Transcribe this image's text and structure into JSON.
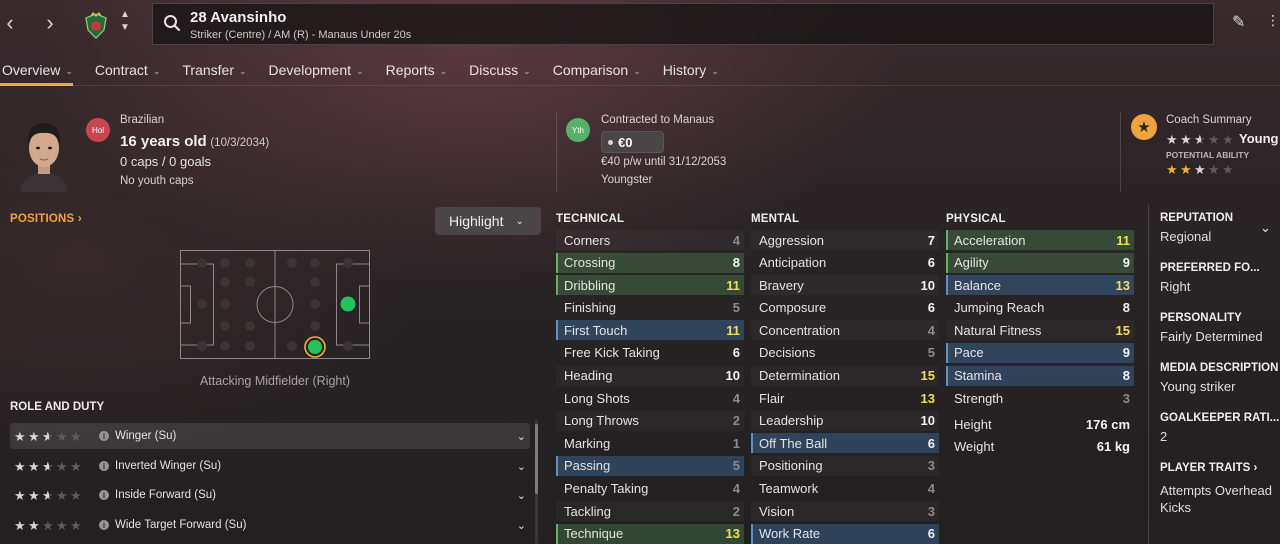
{
  "header": {
    "player_name": "28 Avansinho",
    "player_sub": "Striker (Centre) / AM (R) - Manaus Under 20s"
  },
  "tabs": [
    {
      "label": "Overview"
    },
    {
      "label": "Contract"
    },
    {
      "label": "Transfer"
    },
    {
      "label": "Development"
    },
    {
      "label": "Reports"
    },
    {
      "label": "Discuss"
    },
    {
      "label": "Comparison"
    },
    {
      "label": "History"
    }
  ],
  "info": {
    "nationality_badge": "Hol",
    "nationality": "Brazilian",
    "age": "16 years old",
    "dob": "(10/3/2034)",
    "caps_goals": "0 caps / 0 goals",
    "youth_caps": "No youth caps",
    "contract_badge": "Yth",
    "contracted_to": "Contracted to Manaus",
    "value": "€0",
    "wage": "€40 p/w until 31/12/2053",
    "contract_type": "Youngster",
    "coach_summary_label": "Coach Summary",
    "coach_summary_value": "Young",
    "potential_label": "POTENTIAL ABILITY",
    "current_ability_stars": 2.5,
    "potential_ability_stars": 3
  },
  "positions": {
    "title": "POSITIONS ›",
    "highlight_label": "Highlight",
    "position_label": "Attacking Midfielder (Right)"
  },
  "roles": {
    "title": "ROLE AND DUTY",
    "items": [
      {
        "name": "Winger (Su)",
        "stars": 2.5
      },
      {
        "name": "Inverted Winger (Su)",
        "stars": 2.5
      },
      {
        "name": "Inside Forward (Su)",
        "stars": 2.5
      },
      {
        "name": "Wide Target Forward (Su)",
        "stars": 2
      }
    ]
  },
  "technical": {
    "title": "TECHNICAL",
    "rows": [
      {
        "name": "Corners",
        "value": "4",
        "hl": "plain"
      },
      {
        "name": "Crossing",
        "value": "8",
        "hl": "green"
      },
      {
        "name": "Dribbling",
        "value": "11",
        "hl": "green"
      },
      {
        "name": "Finishing",
        "value": "5",
        "hl": "plain"
      },
      {
        "name": "First Touch",
        "value": "11",
        "hl": "blue"
      },
      {
        "name": "Free Kick Taking",
        "value": "6",
        "hl": "plain"
      },
      {
        "name": "Heading",
        "value": "10",
        "hl": "plain"
      },
      {
        "name": "Long Shots",
        "value": "4",
        "hl": "plain"
      },
      {
        "name": "Long Throws",
        "value": "2",
        "hl": "plain"
      },
      {
        "name": "Marking",
        "value": "1",
        "hl": "plain"
      },
      {
        "name": "Passing",
        "value": "5",
        "hl": "blue"
      },
      {
        "name": "Penalty Taking",
        "value": "4",
        "hl": "plain"
      },
      {
        "name": "Tackling",
        "value": "2",
        "hl": "plain"
      },
      {
        "name": "Technique",
        "value": "13",
        "hl": "green"
      }
    ]
  },
  "mental": {
    "title": "MENTAL",
    "rows": [
      {
        "name": "Aggression",
        "value": "7",
        "hl": "plain"
      },
      {
        "name": "Anticipation",
        "value": "6",
        "hl": "plain"
      },
      {
        "name": "Bravery",
        "value": "10",
        "hl": "plain"
      },
      {
        "name": "Composure",
        "value": "6",
        "hl": "plain"
      },
      {
        "name": "Concentration",
        "value": "4",
        "hl": "plain"
      },
      {
        "name": "Decisions",
        "value": "5",
        "hl": "plain"
      },
      {
        "name": "Determination",
        "value": "15",
        "hl": "plain"
      },
      {
        "name": "Flair",
        "value": "13",
        "hl": "plain"
      },
      {
        "name": "Leadership",
        "value": "10",
        "hl": "plain"
      },
      {
        "name": "Off The Ball",
        "value": "6",
        "hl": "blue"
      },
      {
        "name": "Positioning",
        "value": "3",
        "hl": "plain"
      },
      {
        "name": "Teamwork",
        "value": "4",
        "hl": "plain"
      },
      {
        "name": "Vision",
        "value": "3",
        "hl": "plain"
      },
      {
        "name": "Work Rate",
        "value": "6",
        "hl": "blue"
      }
    ]
  },
  "physical": {
    "title": "PHYSICAL",
    "rows": [
      {
        "name": "Acceleration",
        "value": "11",
        "hl": "green"
      },
      {
        "name": "Agility",
        "value": "9",
        "hl": "green"
      },
      {
        "name": "Balance",
        "value": "13",
        "hl": "blue"
      },
      {
        "name": "Jumping Reach",
        "value": "8",
        "hl": "plain"
      },
      {
        "name": "Natural Fitness",
        "value": "15",
        "hl": "plain"
      },
      {
        "name": "Pace",
        "value": "9",
        "hl": "blue"
      },
      {
        "name": "Stamina",
        "value": "8",
        "hl": "blue"
      },
      {
        "name": "Strength",
        "value": "3",
        "hl": "plain"
      }
    ],
    "height_label": "Height",
    "height_value": "176 cm",
    "weight_label": "Weight",
    "weight_value": "61 kg"
  },
  "profile": {
    "reputation_label": "REPUTATION",
    "reputation_value": "Regional",
    "foot_label": "PREFERRED FO...",
    "foot_value": "Right",
    "personality_label": "PERSONALITY",
    "personality_value": "Fairly Determined",
    "media_label": "MEDIA DESCRIPTION",
    "media_value": "Young striker",
    "gk_label": "GOALKEEPER RATI...",
    "gk_value": "2",
    "traits_label": "PLAYER TRAITS ›",
    "traits_value": "Attempts Overhead Kicks"
  }
}
